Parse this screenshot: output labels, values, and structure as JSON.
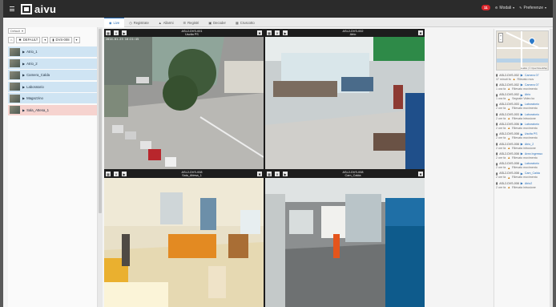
{
  "app": {
    "logo_text": "aivu"
  },
  "topbar": {
    "alert_count": "11",
    "user_label": "Modali",
    "prefs_label": "Preferenze"
  },
  "tabs": [
    {
      "label": "Live",
      "active": true
    },
    {
      "label": "Registrate",
      "active": false
    },
    {
      "label": "Allarmi",
      "active": false
    },
    {
      "label": "Registri",
      "active": false
    },
    {
      "label": "Decoder",
      "active": false
    },
    {
      "label": "Cruscotto",
      "active": false
    }
  ],
  "left_panel": {
    "layout_select": "Default",
    "group_filter": "DEFAULT",
    "device_filter": "DVS-008",
    "cameras": [
      {
        "label": "Atrio_1",
        "alarm": false
      },
      {
        "label": "Atrio_2",
        "alarm": false
      },
      {
        "label": "Camera_Calda",
        "alarm": false
      },
      {
        "label": "Laboratorio",
        "alarm": false
      },
      {
        "label": "Magazzino",
        "alarm": false
      },
      {
        "label": "Sala_Attesa_1",
        "alarm": true
      }
    ]
  },
  "videos": [
    {
      "title_line1": "ASL2-DVS-001",
      "title_line2": "Uscita PS",
      "timestamp": "2014-01-23 10:21:45"
    },
    {
      "title_line1": "ASL2-DVS-002",
      "title_line2": "Atrio",
      "timestamp": ""
    },
    {
      "title_line1": "ASL2-DVS-008",
      "title_line2": "Sala_Attesa_1",
      "timestamp": ""
    },
    {
      "title_line1": "ASL2-DVS-008",
      "title_line2": "Cam_Calda",
      "timestamp": ""
    }
  ],
  "map": {
    "attribution": "Leaflet | © OpenStreetMap"
  },
  "events": [
    {
      "device": "ASL2-DVS-002",
      "cam": "Camera 07",
      "ago": "37 minuti fa",
      "type": "Rilevato mov"
    },
    {
      "device": "ASL2-DVS-002",
      "cam": "Camera 07",
      "ago": "1 ora fa",
      "type": "Rilevato movimento"
    },
    {
      "device": "ASL2-DVS-002",
      "cam": "Atrio",
      "ago": "1 ora fa",
      "type": "Segnale Video ko"
    },
    {
      "device": "ASL2-DVS-003",
      "cam": "Laboratorio",
      "ago": "2 ore fa",
      "type": "Rilevato movimento"
    },
    {
      "device": "ASL2-DVS-003",
      "cam": "Laboratorio",
      "ago": "2 ore fa",
      "type": "Rilevata intrusione"
    },
    {
      "device": "ASL2-DVS-006",
      "cam": "Laboratorio",
      "ago": "2 ore fa",
      "type": "Rilevato movimento"
    },
    {
      "device": "ASL2-DVS-008",
      "cam": "Uscita PS",
      "ago": "2 ore fa",
      "type": "Rilevato movimento"
    },
    {
      "device": "ASL2-DVS-008",
      "cam": "Atrio_2",
      "ago": "2 ore fa",
      "type": "Rilevata intrusione"
    },
    {
      "device": "ASL2-DVS-008",
      "cam": "Area Ingresso",
      "ago": "2 ore fa",
      "type": "Rilevato movimento"
    },
    {
      "device": "ASL2-DVS-008",
      "cam": "Laboratorio",
      "ago": "2 ore fa",
      "type": "Rilevato movimento"
    },
    {
      "device": "ASL2-DVS-008",
      "cam": "Cam_Calda",
      "ago": "2 ore fa",
      "type": "Rilevato movimento"
    },
    {
      "device": "ASL2-DVS-008",
      "cam": "Atrio2",
      "ago": "2 ore fa",
      "type": "Rilevata intrusione"
    }
  ]
}
